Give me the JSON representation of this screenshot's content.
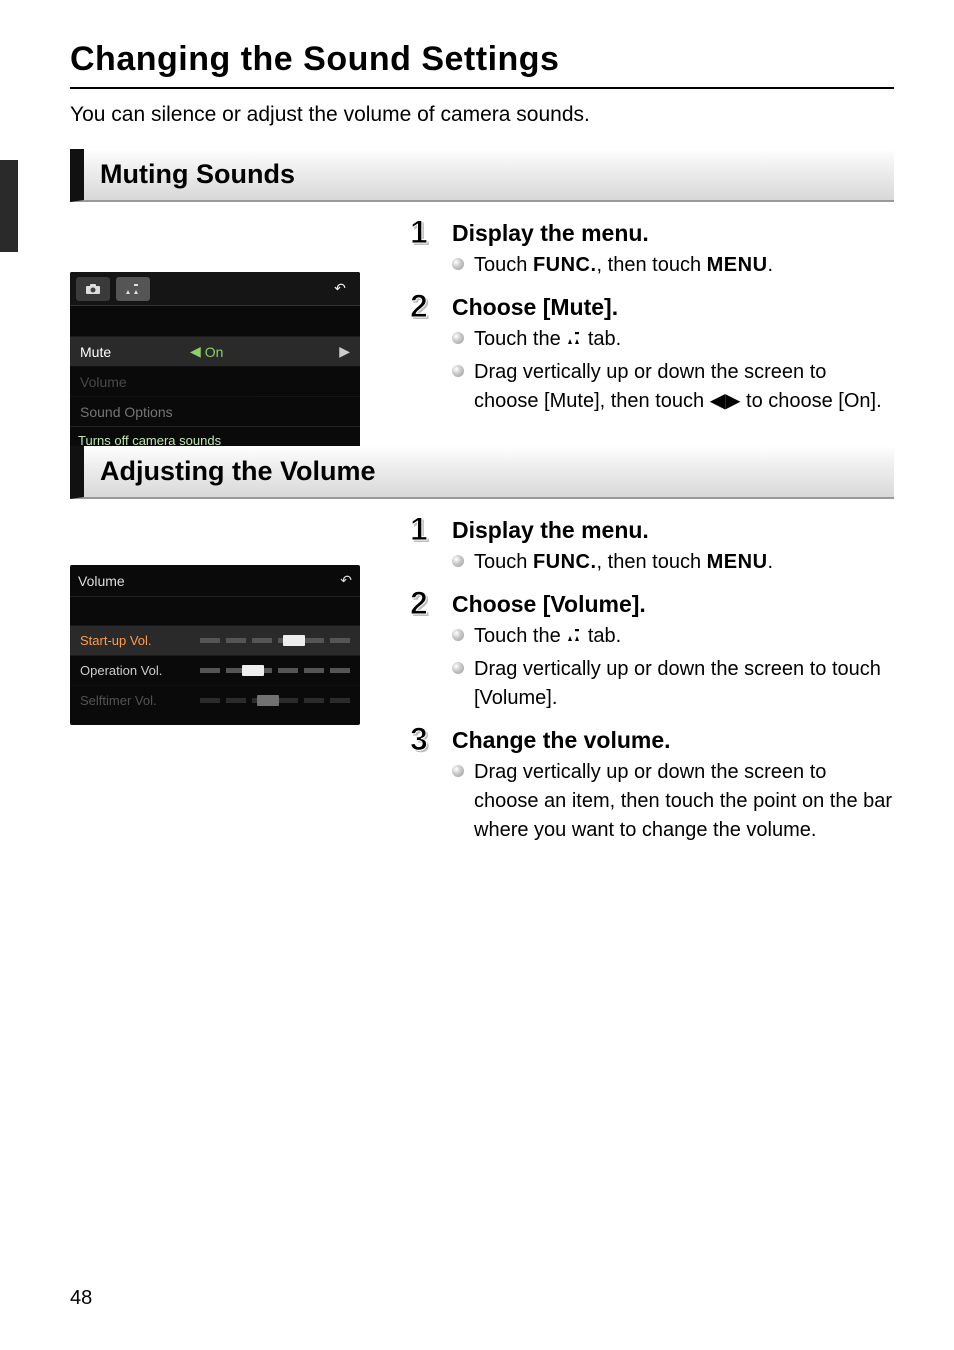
{
  "page": {
    "number": "48",
    "title": "Changing the Sound Settings",
    "intro": "You can silence or adjust the volume of camera sounds."
  },
  "section_muting": {
    "heading": "Muting Sounds",
    "screenshot": {
      "tabs": {
        "camera": "camera-icon",
        "tools": "tools-icon"
      },
      "back_icon": "↶",
      "rows": {
        "mute_label": "Mute",
        "mute_value": "On",
        "volume_label": "Volume",
        "sound_options_label": "Sound Options"
      },
      "hint": "Turns off camera sounds"
    },
    "steps": [
      {
        "num": "1",
        "title": "Display the menu.",
        "bullets": [
          {
            "pre": "Touch ",
            "kw1": "FUNC.",
            "mid": ", then touch ",
            "kw2": "MENU",
            "post": "."
          }
        ]
      },
      {
        "num": "2",
        "title": "Choose [Mute].",
        "bullets": [
          {
            "pre": "Touch the ",
            "icon": "tools",
            "post": " tab."
          },
          {
            "text": "Drag vertically up or down the screen to choose [Mute], then touch ◀▶ to choose [On]."
          }
        ]
      }
    ]
  },
  "section_volume": {
    "heading": "Adjusting the Volume",
    "screenshot": {
      "title": "Volume",
      "back_icon": "↶",
      "rows": {
        "startup": "Start-up Vol.",
        "operation": "Operation Vol.",
        "selftimer": "Selftimer Vol."
      }
    },
    "steps": [
      {
        "num": "1",
        "title": "Display the menu.",
        "bullets": [
          {
            "pre": "Touch ",
            "kw1": "FUNC.",
            "mid": ", then touch ",
            "kw2": "MENU",
            "post": "."
          }
        ]
      },
      {
        "num": "2",
        "title": "Choose [Volume].",
        "bullets": [
          {
            "pre": "Touch the ",
            "icon": "tools",
            "post": " tab."
          },
          {
            "text": "Drag vertically up or down the screen to touch [Volume]."
          }
        ]
      },
      {
        "num": "3",
        "title": "Change the volume.",
        "bullets": [
          {
            "text": "Drag vertically up or down the screen to choose an item, then touch the point on the bar where you want to change the volume."
          }
        ]
      }
    ]
  }
}
